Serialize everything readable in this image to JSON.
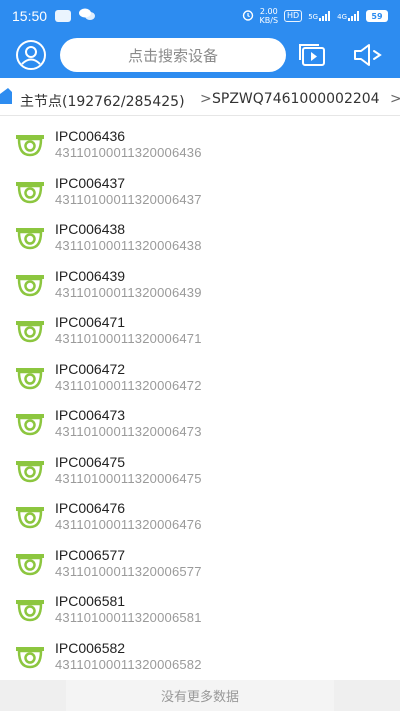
{
  "status_bar": {
    "time": "15:50",
    "speed_value": "2.00",
    "speed_unit": "KB/S",
    "hd_badge": "HD",
    "signal_1": "5G",
    "signal_2": "4G",
    "battery": "59"
  },
  "header": {
    "search_placeholder": "点击搜索设备",
    "accent_color": "#2d8cf0"
  },
  "breadcrumb": {
    "items": [
      {
        "label": "主节点(192762/285425)"
      },
      {
        "label": "SPZWQ7461000002204"
      }
    ],
    "separator": ">"
  },
  "devices": [
    {
      "name": "IPC006436",
      "code": "43110100011320006436"
    },
    {
      "name": "IPC006437",
      "code": "43110100011320006437"
    },
    {
      "name": "IPC006438",
      "code": "43110100011320006438"
    },
    {
      "name": "IPC006439",
      "code": "43110100011320006439"
    },
    {
      "name": "IPC006471",
      "code": "43110100011320006471"
    },
    {
      "name": "IPC006472",
      "code": "43110100011320006472"
    },
    {
      "name": "IPC006473",
      "code": "43110100011320006473"
    },
    {
      "name": "IPC006475",
      "code": "43110100011320006475"
    },
    {
      "name": "IPC006476",
      "code": "43110100011320006476"
    },
    {
      "name": "IPC006577",
      "code": "43110100011320006577"
    },
    {
      "name": "IPC006581",
      "code": "43110100011320006581"
    },
    {
      "name": "IPC006582",
      "code": "43110100011320006582"
    }
  ],
  "footer": {
    "no_more_text": "没有更多数据"
  },
  "icons": {
    "device": "camera-icon",
    "user": "user-icon",
    "playback": "playback-icon",
    "speaker": "speaker-icon"
  }
}
